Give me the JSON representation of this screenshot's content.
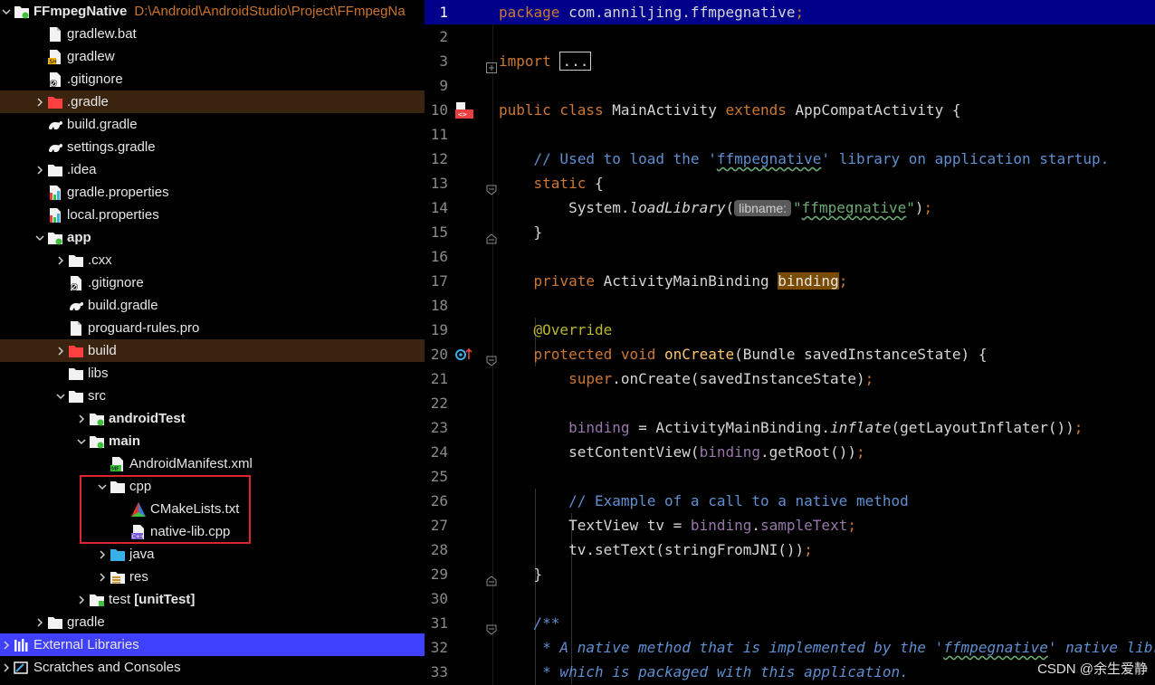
{
  "tree": {
    "project": {
      "name": "FFmpegNative",
      "path": "D:\\Android\\AndroidStudio\\Project\\FFmpegNa"
    },
    "rows": [
      {
        "label": "FFmpegNative",
        "indent": 0,
        "arrow": "down",
        "icon": "module-folder-icon",
        "bold": true,
        "path": true
      },
      {
        "label": "gradlew.bat",
        "indent": 1,
        "arrow": "none",
        "icon": "file-icon"
      },
      {
        "label": "gradlew",
        "indent": 1,
        "arrow": "none",
        "icon": "shell-file-icon"
      },
      {
        "label": ".gitignore",
        "indent": 1,
        "arrow": "none",
        "icon": "gitignore-file-icon"
      },
      {
        "label": ".gradle",
        "indent": 1,
        "arrow": "right",
        "icon": "excluded-folder-icon",
        "row_style": "dark"
      },
      {
        "label": "build.gradle",
        "indent": 1,
        "arrow": "none",
        "icon": "gradle-file-icon"
      },
      {
        "label": "settings.gradle",
        "indent": 1,
        "arrow": "none",
        "icon": "gradle-file-icon"
      },
      {
        "label": ".idea",
        "indent": 1,
        "arrow": "right",
        "icon": "folder-icon"
      },
      {
        "label": "gradle.properties",
        "indent": 1,
        "arrow": "none",
        "icon": "properties-file-icon"
      },
      {
        "label": "local.properties",
        "indent": 1,
        "arrow": "none",
        "icon": "properties-file-icon"
      },
      {
        "label": "app",
        "indent": 1,
        "arrow": "down",
        "icon": "module-folder-icon",
        "bold": true
      },
      {
        "label": ".cxx",
        "indent": 2,
        "arrow": "right",
        "icon": "folder-icon"
      },
      {
        "label": ".gitignore",
        "indent": 2,
        "arrow": "none",
        "icon": "gitignore-file-icon"
      },
      {
        "label": "build.gradle",
        "indent": 2,
        "arrow": "none",
        "icon": "gradle-file-icon"
      },
      {
        "label": "proguard-rules.pro",
        "indent": 2,
        "arrow": "none",
        "icon": "file-icon"
      },
      {
        "label": "build",
        "indent": 2,
        "arrow": "right",
        "icon": "excluded-folder-icon",
        "row_style": "dark"
      },
      {
        "label": "libs",
        "indent": 2,
        "arrow": "none",
        "icon": "folder-icon"
      },
      {
        "label": "src",
        "indent": 2,
        "arrow": "down",
        "icon": "folder-icon"
      },
      {
        "label": "androidTest",
        "indent": 3,
        "arrow": "right",
        "icon": "module-folder-icon",
        "bold": true
      },
      {
        "label": "main",
        "indent": 3,
        "arrow": "down",
        "icon": "module-folder-icon",
        "bold": true
      },
      {
        "label": "AndroidManifest.xml",
        "indent": 4,
        "arrow": "none",
        "icon": "manifest-file-icon"
      },
      {
        "label": "cpp",
        "indent": 4,
        "arrow": "down",
        "icon": "folder-icon"
      },
      {
        "label": "CMakeLists.txt",
        "indent": 5,
        "arrow": "none",
        "icon": "cmake-file-icon"
      },
      {
        "label": "native-lib.cpp",
        "indent": 5,
        "arrow": "none",
        "icon": "cpp-file-icon"
      },
      {
        "label": "java",
        "indent": 4,
        "arrow": "right",
        "icon": "source-folder-icon"
      },
      {
        "label": "res",
        "indent": 4,
        "arrow": "right",
        "icon": "resource-folder-icon"
      },
      {
        "label": "test",
        "suffix": "[unitTest]",
        "indent": 3,
        "arrow": "right",
        "icon": "test-folder-icon"
      },
      {
        "label": "gradle",
        "indent": 1,
        "arrow": "right",
        "icon": "folder-icon"
      },
      {
        "label": "External Libraries",
        "indent": 0,
        "arrow": "right",
        "icon": "libraries-icon",
        "row_style": "blue"
      },
      {
        "label": "Scratches and Consoles",
        "indent": 0,
        "arrow": "right",
        "icon": "scratches-icon"
      }
    ]
  },
  "editor": {
    "current_line": 1,
    "lines": [
      {
        "n": "1",
        "html": "<span class='kw'>package</span> com.anniljing.ffmpegnative<span class='kw'>;</span>"
      },
      {
        "n": "2",
        "html": ""
      },
      {
        "n": "3",
        "html": "<span class='kw'>import</span> <span class='dots'>...</span>",
        "fold": "plus"
      },
      {
        "n": "9",
        "html": ""
      },
      {
        "n": "10",
        "html": "<span class='kw'>public class</span> MainActivity <span class='kw'>extends</span> AppCompatActivity {",
        "gutter": "native-class-icon"
      },
      {
        "n": "11",
        "html": ""
      },
      {
        "n": "12",
        "html": "    <span class='cm'>// Used to load the '<span class='squig'>ffmpegnative</span>' library on application startup.</span>"
      },
      {
        "n": "13",
        "html": "    <span class='kw'>static</span> {",
        "fold": "open"
      },
      {
        "n": "14",
        "html": "        System.<span class='it'>loadLibrary</span>(<span class='hint'>libname:</span><span class='st'>\"<span class='squig'>ffmpegnative</span>\"</span>)<span class='kw'>;</span>"
      },
      {
        "n": "15",
        "html": "    }",
        "fold": "close"
      },
      {
        "n": "16",
        "html": ""
      },
      {
        "n": "17",
        "html": "    <span class='kw'>private</span> ActivityMainBinding <span class='hl'>binding</span><span class='kw'>;</span>"
      },
      {
        "n": "18",
        "html": ""
      },
      {
        "n": "19",
        "html": "    <span class='an'>@Override</span>"
      },
      {
        "n": "20",
        "html": "    <span class='kw'>protected void</span> <span class='fn'>onCreate</span>(Bundle savedInstanceState) {",
        "gutter": "override-icon",
        "fold": "open"
      },
      {
        "n": "21",
        "html": "        <span class='kw'>super</span>.onCreate(savedInstanceState)<span class='kw'>;</span>"
      },
      {
        "n": "22",
        "html": ""
      },
      {
        "n": "23",
        "html": "        <span class='fd'>binding</span> = ActivityMainBinding.<span class='it'>inflate</span>(getLayoutInflater())<span class='kw'>;</span>"
      },
      {
        "n": "24",
        "html": "        setContentView(<span class='fd'>binding</span>.getRoot())<span class='kw'>;</span>"
      },
      {
        "n": "25",
        "html": ""
      },
      {
        "n": "26",
        "html": "        <span class='cm'>// Example of a call to a native method</span>"
      },
      {
        "n": "27",
        "html": "        TextView tv = <span class='fd'>binding</span>.<span class='fd'>sampleText</span><span class='kw'>;</span>"
      },
      {
        "n": "28",
        "html": "        tv.setText(stringFromJNI())<span class='kw'>;</span>"
      },
      {
        "n": "29",
        "html": "    }",
        "fold": "close"
      },
      {
        "n": "30",
        "html": ""
      },
      {
        "n": "31",
        "html": "    <span class='cm it'>/**</span>",
        "fold": "open"
      },
      {
        "n": "32",
        "html": "<span class='cm it'>     * A native method that is implemented by the '<span class='squig'>ffmpegnative</span>' native library,</span>"
      },
      {
        "n": "33",
        "html": "<span class='cm it'>     * which is packaged with this application.</span>"
      }
    ]
  },
  "watermark": "CSDN @余生爱静",
  "colors": {
    "accent": "#4040ff",
    "excluded_row": "#3a2410",
    "current_line": "#00008a",
    "highlight_box": "#e0242c"
  }
}
